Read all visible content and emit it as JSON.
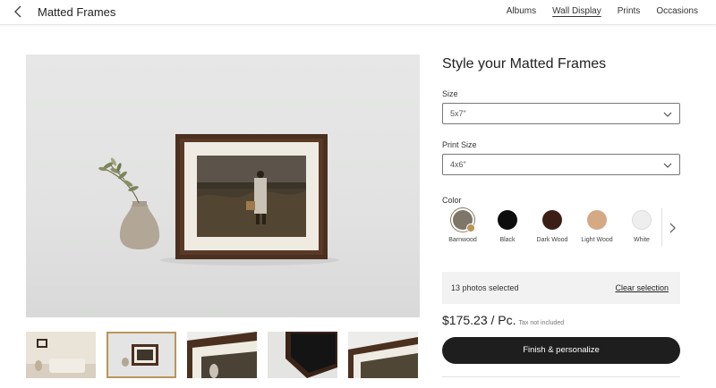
{
  "header": {
    "title": "Matted Frames",
    "nav": [
      {
        "label": "Albums",
        "active": false
      },
      {
        "label": "Wall Display",
        "active": true
      },
      {
        "label": "Prints",
        "active": false
      },
      {
        "label": "Occasions",
        "active": false
      }
    ]
  },
  "panel": {
    "title": "Style your Matted Frames",
    "size": {
      "label": "Size",
      "value": "5x7\""
    },
    "print_size": {
      "label": "Print Size",
      "value": "4x6\""
    },
    "color": {
      "label": "Color",
      "selected": "Barnwood",
      "options": [
        {
          "name": "Barnwood",
          "hex": "#7e7769"
        },
        {
          "name": "Black",
          "hex": "#0d0d0d"
        },
        {
          "name": "Dark Wood",
          "hex": "#3b1f16"
        },
        {
          "name": "Light Wood",
          "hex": "#d4a984"
        },
        {
          "name": "White",
          "hex": "#eeeeee"
        }
      ]
    },
    "selection": {
      "count_text": "13 photos selected",
      "clear_label": "Clear selection"
    },
    "price": {
      "amount": "$175.23 / Pc.",
      "tax_note": "Tax not included"
    },
    "cta_label": "Finish & personalize"
  },
  "colors": {
    "accent": "#b9955a",
    "cta": "#1e1e1e",
    "frame_dark_wood": "#4a2e1e"
  },
  "thumbnails": [
    {
      "name": "living-room",
      "selected": false
    },
    {
      "name": "frame-front",
      "selected": true
    },
    {
      "name": "frame-corner-closeup",
      "selected": false
    },
    {
      "name": "frame-back",
      "selected": false
    },
    {
      "name": "frame-angle",
      "selected": false
    }
  ]
}
